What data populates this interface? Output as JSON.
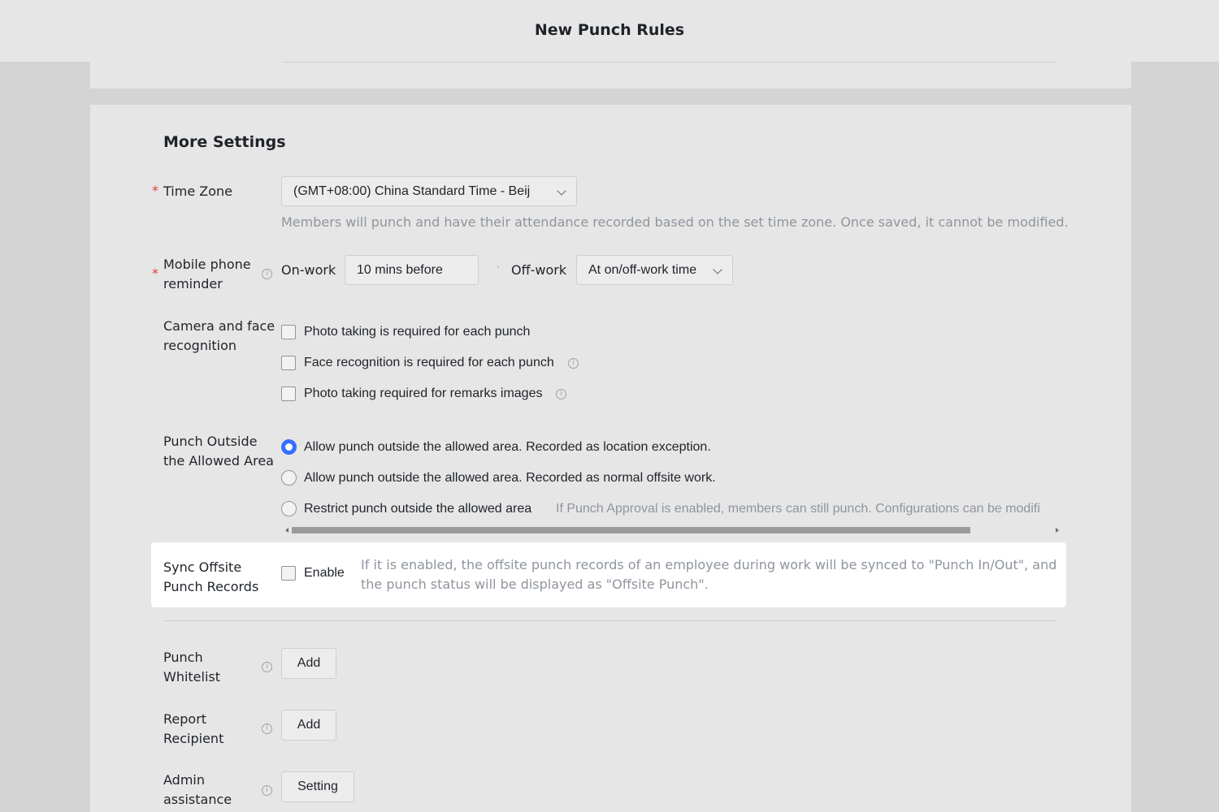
{
  "header": {
    "title": "New Punch Rules"
  },
  "more_settings": {
    "title": "More Settings",
    "required_mark": "*",
    "time_zone": {
      "label": "Time Zone",
      "value": "(GMT+08:00) China Standard Time - Beij",
      "help": "Members will punch and have their attendance recorded based on the set time zone. Once saved, it cannot be modified."
    },
    "mobile_reminder": {
      "label_line1": "Mobile phone",
      "label_line2": "reminder",
      "onwork_label": "On-work",
      "onwork_value": "10 mins before",
      "separator": "·",
      "offwork_label": "Off-work",
      "offwork_value": "At on/off-work time"
    },
    "camera": {
      "label_line1": "Camera and face",
      "label_line2": "recognition",
      "options": [
        {
          "label": "Photo taking is required for each punch",
          "checked": false
        },
        {
          "label": "Face recognition is required for each punch",
          "checked": false
        },
        {
          "label": "Photo taking required for remarks images",
          "checked": false
        }
      ]
    },
    "punch_outside": {
      "label_line1": "Punch Outside",
      "label_line2": "the Allowed Area",
      "options": [
        {
          "label": "Allow punch outside the allowed area. Recorded as location exception.",
          "selected": true
        },
        {
          "label": "Allow punch outside the allowed area. Recorded as normal offsite work.",
          "selected": false
        },
        {
          "label": "Restrict punch outside the allowed area",
          "selected": false
        }
      ],
      "restrict_note": "If Punch Approval is enabled, members can still punch. Configurations can be modifi"
    },
    "sync_offsite": {
      "label_line1": "Sync Offsite",
      "label_line2": "Punch Records",
      "enable_label": "Enable",
      "enabled": false,
      "help_line1": "If it is enabled, the offsite punch records of an employee during work will be synced to \"Punch In/Out\", and",
      "help_line2": "the punch status will be displayed as \"Offsite Punch\"."
    },
    "punch_whitelist": {
      "label_line1": "Punch",
      "label_line2": "Whitelist",
      "button": "Add"
    },
    "report_recipient": {
      "label_line1": "Report",
      "label_line2": "Recipient",
      "button": "Add"
    },
    "admin_assistance": {
      "label_line1": "Admin",
      "label_line2": "assistance",
      "button": "Setting"
    }
  },
  "colors": {
    "accent": "#3370ff",
    "required": "#e0413a",
    "highlight": "#ffffff"
  }
}
